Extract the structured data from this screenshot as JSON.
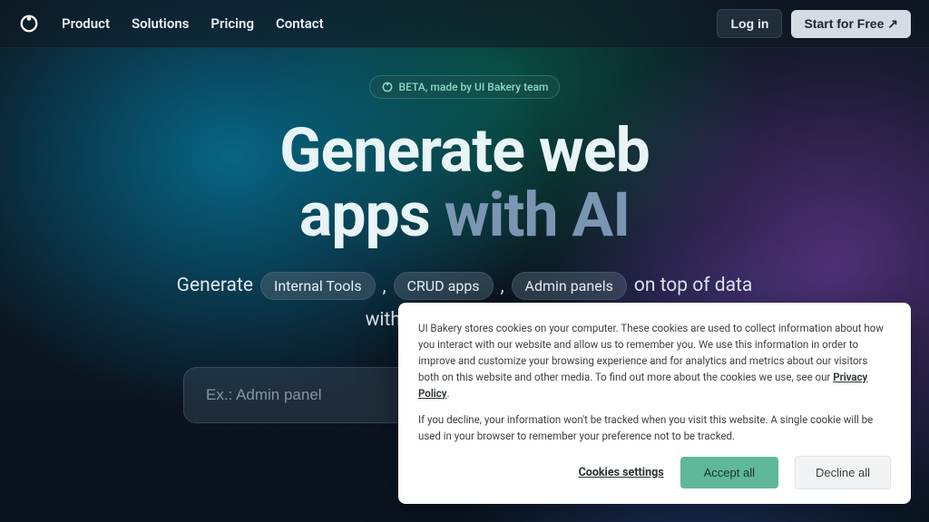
{
  "nav": {
    "items": [
      "Product",
      "Solutions",
      "Pricing",
      "Contact"
    ],
    "login": "Log in",
    "start": "Start for Free ↗"
  },
  "hero": {
    "badge": "BETA, made by UI Bakery team",
    "headline_line1": "Generate web",
    "headline_apps": "apps",
    "headline_withai": " with AI",
    "sub_prefix": "Generate",
    "chips": [
      "Internal Tools",
      "CRUD apps",
      "Admin panels"
    ],
    "sub_suffix": "on top of data",
    "sub_line2": "with only a text prompt.",
    "prompt_placeholder": "Ex.: Admin panel"
  },
  "cookie": {
    "p1_a": "UI Bakery stores cookies on your computer. These cookies are used to collect information about how you interact with our website and allow us to remember you. We use this information in order to improve and customize your browsing experience and for analytics and metrics about our visitors both on this website and other media. To find out more about the cookies we use, see our ",
    "p1_link": "Privacy Policy",
    "p1_b": ".",
    "p2": "If you decline, your information won't be tracked when you visit this website. A single cookie will be used in your browser to remember your preference not to be tracked.",
    "settings": "Cookies settings",
    "accept": "Accept all",
    "decline": "Decline all"
  }
}
